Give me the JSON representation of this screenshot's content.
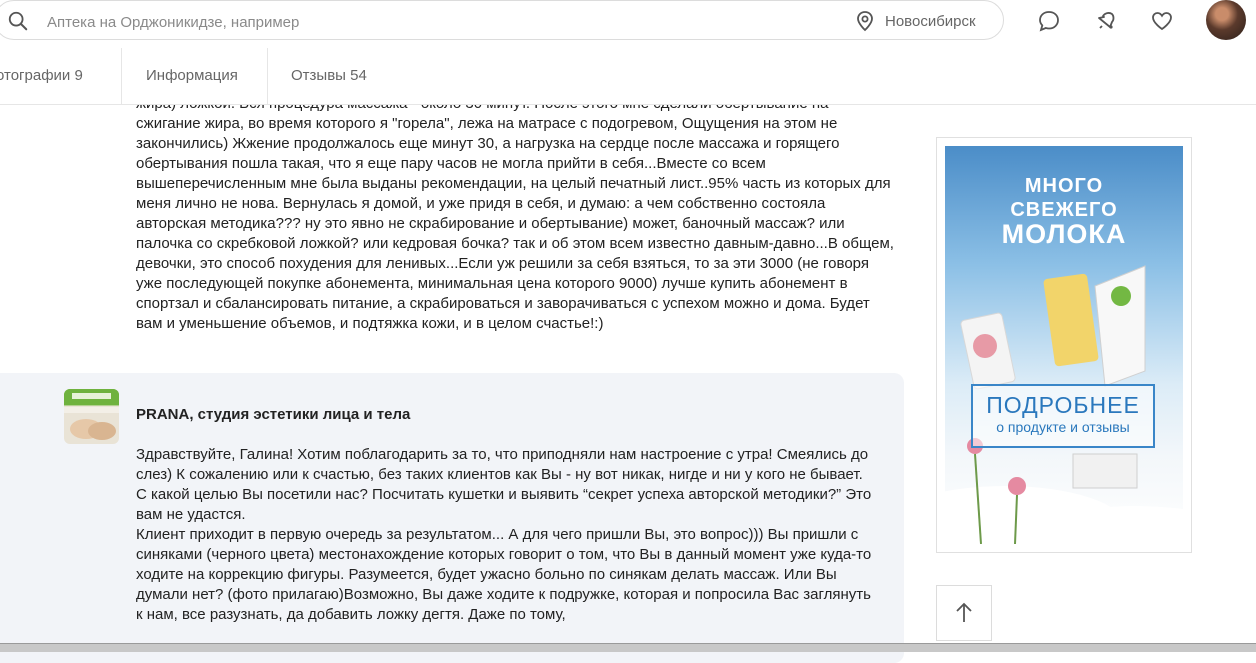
{
  "search": {
    "placeholder": "Аптека на Орджоникидзе, например",
    "city": "Новосибирск"
  },
  "header_icons": [
    "chat-icon",
    "notification-icon",
    "favorites-icon"
  ],
  "tabs": [
    {
      "label": "отографии 9"
    },
    {
      "label": "Информация"
    },
    {
      "label": "Отзывы 54"
    }
  ],
  "review": {
    "paragraphs": [
      "жира) ложкой. Вся процедура массажа - около 30 минут. После этого мне сделали обертывание на сжигание жира, во время которого я \"горела\", лежа на матрасе с подогревом, Ощущения на этом не закончились) Жжение продолжалось еще минут 30, а нагрузка на сердце после массажа и горящего обертывания пошла такая, что я еще пару часов не могла прийти в себя...Вместе со всем вышеперечисленным мне была выданы рекомендации, на целый печатный лист..95% часть из которых для меня лично не нова. Вернулась я домой, и уже придя в себя, и думаю: а чем собственно состояла авторская методика??? ну это явно не скрабирование и обертывание) может, баночный массаж? или палочка со скребковой ложкой? или кедровая бочка? так и об этом всем известно давным-давно...В общем, девочки, это способ похудения для ленивых...Если уж решили за себя взяться, то за эти 3000 (не говоря уже последующей покупке абонемента, минимальная цена которого 9000) лучше купить абонемент в спортзал и сбалансировать питание, а скрабироваться и заворачиваться с успехом можно и дома. Будет вам и уменьшение объемов, и подтяжка кожи, и в целом счастье!:)"
    ]
  },
  "response": {
    "org_name": "PRANA, студия эстетики лица и тела",
    "paragraphs": [
      "Здравствуйте, Галина! Хотим поблагодарить за то, что приподняли нам настроение с утра! Смеялись до слез) К сожалению или к счастью, без таких клиентов как Вы - ну вот никак, нигде и ни у кого не бывает.",
      "С какой целью Вы посетили нас? Посчитать кушетки и выявить “секрет успеха авторской методики?” Это вам не удастся.",
      "Клиент приходит в первую очередь за результатом... А для чего пришли Вы, это вопрос))) Вы пришли с синяками (черного цвета) местонахождение которых говорит о том, что Вы в данный момент уже куда-то ходите на коррекцию фигуры. Разумеется, будет ужасно больно по синякам делать массаж. Или Вы думали нет? (фото прилагаю)Возможно, Вы даже ходите к подружке, которая и попросила Вас заглянуть к нам, все разузнать, да добавить ложку дегтя. Даже по тому,"
    ]
  },
  "ad": {
    "title_line1": "МНОГО",
    "title_line2": "СВЕЖЕГО",
    "title_line3": "МОЛОКА",
    "more_label": "ПОДРОБНЕЕ",
    "more_sub": "о продукте и отзывы"
  },
  "colors": {
    "accent": "#2a78bd",
    "response_bg": "#f2f4f8"
  }
}
